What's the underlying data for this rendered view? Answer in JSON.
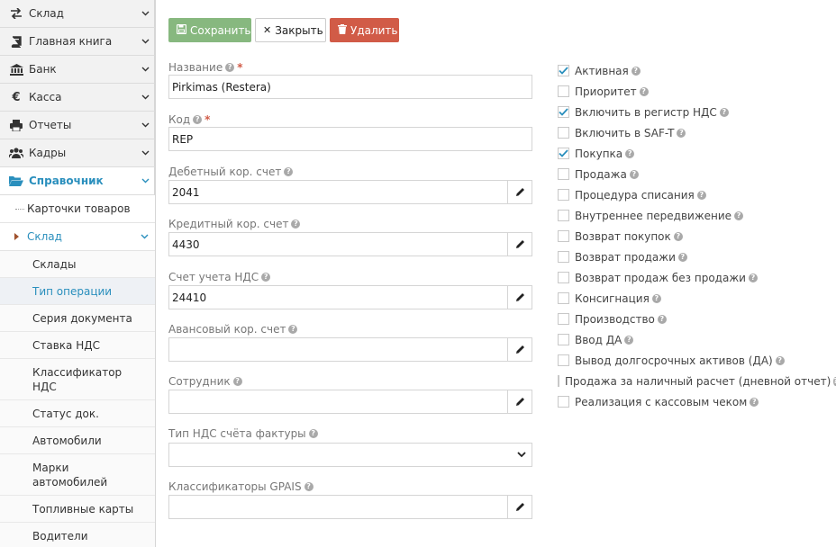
{
  "sidebar": {
    "top_items": [
      {
        "label": "Склад",
        "icon": "exchange-icon"
      },
      {
        "label": "Главная книга",
        "icon": "book-icon"
      },
      {
        "label": "Банк",
        "icon": "bank-icon"
      },
      {
        "label": "Касса",
        "icon": "euro-icon"
      },
      {
        "label": "Отчеты",
        "icon": "print-icon"
      },
      {
        "label": "Кадры",
        "icon": "users-icon"
      }
    ],
    "active_section": {
      "label": "Справочник",
      "icon": "folder-open-icon"
    },
    "sub_items": [
      {
        "label": "Карточки товаров"
      },
      {
        "label": "Склад"
      }
    ],
    "leaves": [
      {
        "label": "Склады"
      },
      {
        "label": "Тип операции"
      },
      {
        "label": "Серия документа"
      },
      {
        "label": "Ставка НДС"
      },
      {
        "label": "Классификатор\nНДС"
      },
      {
        "label": "Статус док."
      },
      {
        "label": "Автомобили"
      },
      {
        "label": "Марки\nавтомобилей"
      },
      {
        "label": "Топливные карты"
      },
      {
        "label": "Водители"
      }
    ]
  },
  "toolbar": {
    "save_label": "Сохранить",
    "close_label": "Закрыть",
    "delete_label": "Удалить",
    "colors": {
      "save": "#87b87f",
      "delete": "#d15b47"
    }
  },
  "form": {
    "name": {
      "label": "Название",
      "value": "Pirkimas (Restera)"
    },
    "code": {
      "label": "Код",
      "value": "REP"
    },
    "debit": {
      "label": "Дебетный кор. счет",
      "value": "2041"
    },
    "credit": {
      "label": "Кредитный кор. счет",
      "value": "4430"
    },
    "vat_account": {
      "label": "Счет учета НДС",
      "value": "24410"
    },
    "advance": {
      "label": "Авансовый кор. счет",
      "value": ""
    },
    "employee": {
      "label": "Сотрудник",
      "value": ""
    },
    "invoice_vat_type": {
      "label": "Тип НДС счёта фактуры",
      "value": ""
    },
    "gpais": {
      "label": "Классификаторы GPAIS",
      "value": ""
    }
  },
  "options": [
    {
      "label": "Активная",
      "checked": true
    },
    {
      "label": "Приоритет",
      "checked": false
    },
    {
      "label": "Включить в регистр НДС",
      "checked": true
    },
    {
      "label": "Включить в SAF-T",
      "checked": false
    },
    {
      "label": "Покупка",
      "checked": true
    },
    {
      "label": "Продажа",
      "checked": false
    },
    {
      "label": "Процедура списания",
      "checked": false
    },
    {
      "label": "Внутреннее передвижение",
      "checked": false
    },
    {
      "label": "Возврат покупок",
      "checked": false
    },
    {
      "label": "Возврат продажи",
      "checked": false
    },
    {
      "label": "Возврат продаж без продажи",
      "checked": false
    },
    {
      "label": "Консигнация",
      "checked": false
    },
    {
      "label": "Производство",
      "checked": false
    },
    {
      "label": "Ввод ДА",
      "checked": false
    },
    {
      "label": "Вывод долгосрочных активов (ДА)",
      "checked": false
    },
    {
      "label": "Продажа за наличный расчет (дневной отчет)",
      "checked": false
    },
    {
      "label": "Реализация с кассовым чеком",
      "checked": false
    }
  ],
  "accent_color": "#2a8fbd"
}
